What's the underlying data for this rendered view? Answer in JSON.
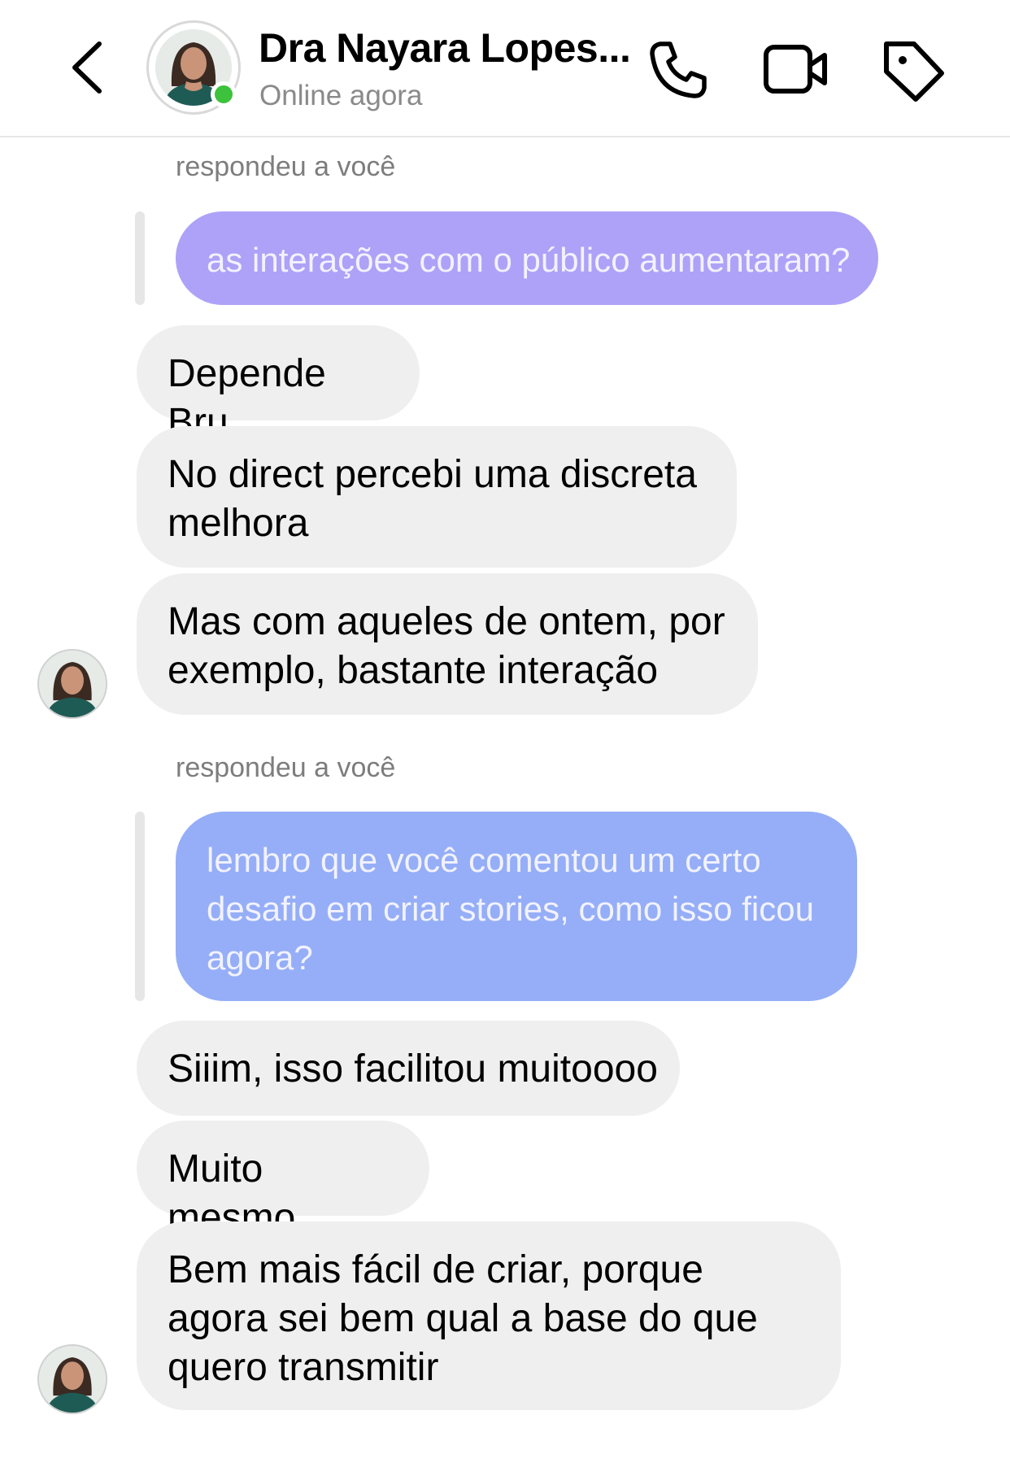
{
  "header": {
    "contact_name": "Dra Nayara Lopes...",
    "status": "Online agora",
    "icons": [
      "chevron-left-icon",
      "phone-icon",
      "video-camera-icon",
      "tag-icon"
    ],
    "online_color": "#3cc23c"
  },
  "messages": [
    {
      "type": "reply-note",
      "text": "respondeu a você"
    },
    {
      "type": "quoted",
      "text": "as interações com o público aumentaram?",
      "color": "#ada2f7"
    },
    {
      "type": "incoming",
      "text": "Depende Bru"
    },
    {
      "type": "incoming",
      "text": "No direct percebi uma discreta melhora"
    },
    {
      "type": "incoming",
      "text": "Mas com aqueles de ontem, por exemplo, bastante interação"
    },
    {
      "type": "reply-note",
      "text": "respondeu a você"
    },
    {
      "type": "quoted",
      "text": "lembro que você comentou um certo desafio em criar stories, como isso ficou agora?",
      "color": "#95aef7"
    },
    {
      "type": "incoming",
      "text": "Siiim, isso facilitou muitoooo"
    },
    {
      "type": "incoming",
      "text": "Muito mesmo"
    },
    {
      "type": "incoming",
      "text": "Bem mais fácil de criar, porque agora sei bem qual a base do que quero transmitir"
    }
  ]
}
